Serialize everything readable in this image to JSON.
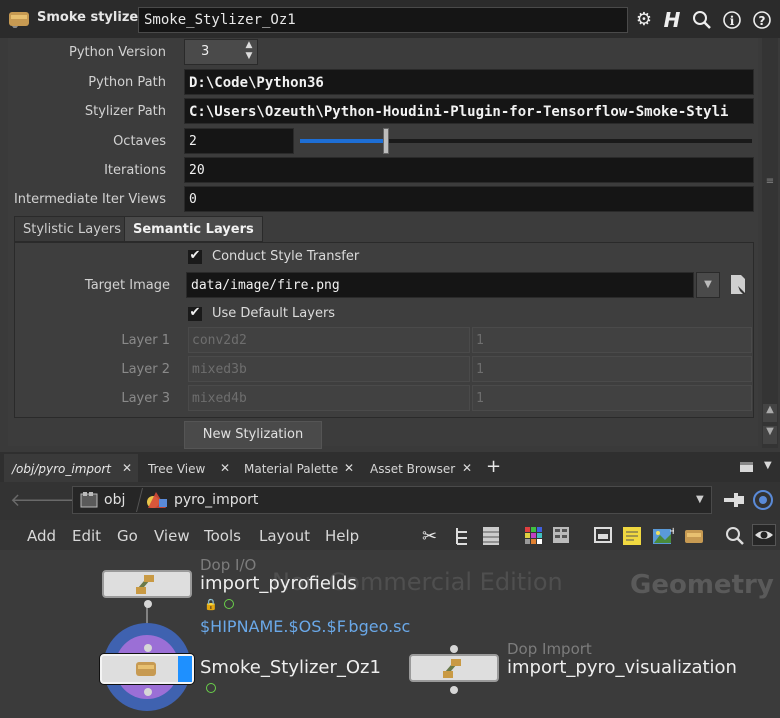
{
  "header": {
    "op_type": "Smoke stylizer",
    "node_name": "Smoke_Stylizer_Oz1",
    "icons": [
      "gear-icon",
      "help-h-icon",
      "search-icon",
      "info-icon",
      "question-icon"
    ]
  },
  "params": {
    "python_version_label": "Python Version",
    "python_version_value": "3",
    "python_path_label": "Python Path",
    "python_path_value": "D:\\Code\\Python36",
    "stylizer_path_label": "Stylizer Path",
    "stylizer_path_value": "C:\\Users\\Ozeuth\\Python-Houdini-Plugin-for-Tensorflow-Smoke-Styli",
    "octaves_label": "Octaves",
    "octaves_value": "2",
    "octaves_slider_fraction": 0.19,
    "iterations_label": "Iterations",
    "iterations_value": "20",
    "intermediate_label": "Intermediate Iter Views",
    "intermediate_value": "0"
  },
  "tabs": {
    "stylistic": "Stylistic Layers",
    "semantic": "Semantic Layers",
    "active": "Semantic Layers"
  },
  "semantic": {
    "conduct_label": "Conduct Style Transfer",
    "conduct_checked": true,
    "target_image_label": "Target Image",
    "target_image_value": "data/image/fire.png",
    "use_default_label": "Use Default Layers",
    "use_default_checked": true,
    "layers": [
      {
        "label": "Layer 1",
        "name": "conv2d2",
        "weight": "1"
      },
      {
        "label": "Layer 2",
        "name": "mixed3b",
        "weight": "1"
      },
      {
        "label": "Layer 3",
        "name": "mixed4b",
        "weight": "1"
      }
    ],
    "new_stylization_button": "New Stylization"
  },
  "pane_tabs": [
    {
      "label": "/obj/pyro_import",
      "active": true
    },
    {
      "label": "Tree View",
      "active": false
    },
    {
      "label": "Material Palette",
      "active": false
    },
    {
      "label": "Asset Browser",
      "active": false
    }
  ],
  "pathbar": {
    "segment_1": "obj",
    "segment_2": "pyro_import"
  },
  "menu": [
    "Add",
    "Edit",
    "Go",
    "View",
    "Tools",
    "Layout",
    "Help"
  ],
  "network": {
    "watermark": "Non-Commercial Edition",
    "context_label": "Geometry",
    "nodes": [
      {
        "type": "Dop I/O",
        "name": "import_pyrofields",
        "subtitle": "$HIPNAME.$OS.$F.bgeo.sc"
      },
      {
        "type": "",
        "name": "Smoke_Stylizer_Oz1",
        "subtitle": ""
      },
      {
        "type": "Dop Import",
        "name": "import_pyro_visualization",
        "subtitle": ""
      }
    ]
  },
  "colors": {
    "accent_blue": "#1e90ff",
    "node_ring": "#3f62b0",
    "node_inner": "#9b6fd6",
    "subtitle_blue": "#6aa8e8"
  }
}
